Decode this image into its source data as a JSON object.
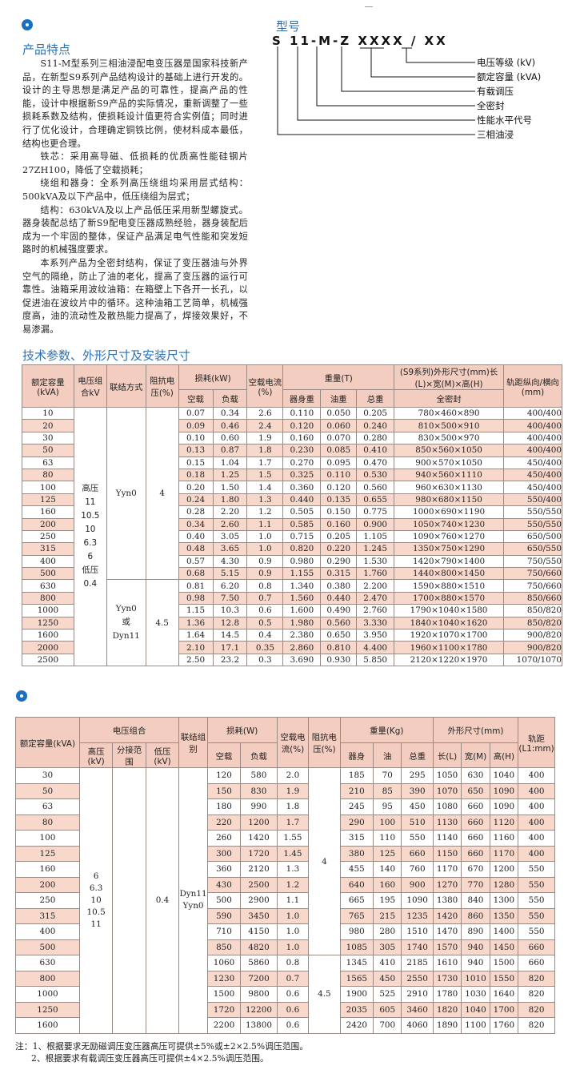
{
  "features": {
    "title": "产品特点",
    "paragraphs": [
      "S11-M型系列三相油浸配电变压器是国家科技新产品，在新型S9系列产品结构设计的基础上进行开发的。设计的主导思想是满足产品的可靠性，提高产品的性能，设计中根据新S9产品的实际情况，重新调整了一些损耗系数及结构，使损耗设计值更符合实例值；同时进行了优化设计，合理确定铜铁比例，使材料成本最低，结构也更合理。",
      "铁芯：采用高导磁、低损耗的优质高性能硅钢片27ZH100，降低了空载损耗；",
      "绕组和器身：全系列高压绕组均采用层式结构：500kVA及以下产品中，低压绕组为层式；",
      "结构：630kVA及以上产品低压采用新型螺旋式。器身装配总结了新S9配电变压器成熟经验，器身装配后成为一个牢固的整体，保证产品满足电气性能和突发短路时的机械强度要求。",
      "本系列产品为全密封结构，保证了变压器油与外界空气的隔绝，防止了油的老化，提高了变压器的运行可靠性。油箱采用波纹油箱：在箱壁上下各开一长孔，以促进油在波纹片中的循环。这种油箱工艺简单，机械强度高，油的流动性及散热能力提高了，焊接效果好，不易渗漏。"
    ]
  },
  "model": {
    "title": "型号",
    "code": "S 11-M-Z XXXX / XX",
    "labels": [
      "电压等级 (kV)",
      "额定容量 (kVA)",
      "有载调压",
      "全密封",
      "性能水平代号",
      "三相油浸"
    ]
  },
  "table1": {
    "title": "技术参数、外形尺寸及安装尺寸",
    "headers": {
      "capacity": "额定容量(kVA)",
      "voltage": "电压组合kV",
      "group": "联结方式",
      "impedance": "阻抗电压(%)",
      "loss": "损耗(kW)",
      "loss_noload": "空载",
      "loss_load": "负载",
      "noload_current": "空载电流(%)",
      "weight": "重量(T)",
      "w_body": "器身重",
      "w_oil": "油重",
      "w_total": "总重",
      "dims": "(S9系列)外形尺寸(mm)长(L)×宽(M)×高(H)",
      "dims_sub": "全密封",
      "gauge": "轨距纵向/横向(mm)"
    },
    "voltage_text": "高压 11 10.5 10 6.3 6 低压 0.4",
    "group_a": "Yyn0",
    "group_b": "Yyn0 或 Dyn11",
    "imp_a": "4",
    "imp_b": "4.5",
    "rows": [
      [
        "10",
        "0.07",
        "0.34",
        "2.6",
        "0.110",
        "0.050",
        "0.205",
        "780×460×890",
        "400/400"
      ],
      [
        "20",
        "0.09",
        "0.46",
        "2.4",
        "0.120",
        "0.060",
        "0.240",
        "810×500×910",
        "400/400"
      ],
      [
        "30",
        "0.10",
        "0.60",
        "1.9",
        "0.160",
        "0.070",
        "0.280",
        "830×500×970",
        "400/400"
      ],
      [
        "50",
        "0.13",
        "0.87",
        "1.8",
        "0.230",
        "0.085",
        "0.410",
        "850×560×1050",
        "400/400"
      ],
      [
        "63",
        "0.15",
        "1.04",
        "1.7",
        "0.270",
        "0.095",
        "0.470",
        "900×570×1050",
        "450/400"
      ],
      [
        "80",
        "0.18",
        "1.25",
        "1.5",
        "0.325",
        "0.110",
        "0.530",
        "940×560×1110",
        "450/400"
      ],
      [
        "100",
        "0.20",
        "1.50",
        "1.4",
        "0.360",
        "0.120",
        "0.560",
        "960×630×1130",
        "450/400"
      ],
      [
        "125",
        "0.24",
        "1.80",
        "1.3",
        "0.440",
        "0.135",
        "0.655",
        "980×680×1150",
        "550/400"
      ],
      [
        "160",
        "0.28",
        "2.20",
        "1.2",
        "0.505",
        "0.150",
        "0.775",
        "1000×690×1190",
        "550/550"
      ],
      [
        "200",
        "0.34",
        "2.60",
        "1.1",
        "0.585",
        "0.160",
        "0.900",
        "1050×740×1230",
        "550/550"
      ],
      [
        "250",
        "0.40",
        "3.05",
        "1.0",
        "0.715",
        "0.205",
        "1.105",
        "1090×760×1270",
        "650/500"
      ],
      [
        "315",
        "0.48",
        "3.65",
        "1.0",
        "0.820",
        "0.220",
        "1.245",
        "1350×750×1290",
        "650/550"
      ],
      [
        "400",
        "0.57",
        "4.30",
        "0.9",
        "0.980",
        "0.290",
        "1.530",
        "1420×790×1400",
        "750/550"
      ],
      [
        "500",
        "0.68",
        "5.15",
        "0.9",
        "1.155",
        "0.315",
        "1.760",
        "1440×800×1450",
        "750/660"
      ],
      [
        "630",
        "0.81",
        "6.20",
        "0.8",
        "1.340",
        "0.380",
        "2.200",
        "1590×880×1510",
        "750/660"
      ],
      [
        "800",
        "0.98",
        "7.50",
        "0.7",
        "1.560",
        "0.440",
        "2.470",
        "1700×880×1570",
        "850/660"
      ],
      [
        "1000",
        "1.15",
        "10.3",
        "0.6",
        "1.600",
        "0.490",
        "2.760",
        "1790×1040×1580",
        "850/820"
      ],
      [
        "1250",
        "1.36",
        "12.8",
        "0.5",
        "1.980",
        "0.560",
        "3.330",
        "1840×1040×1620",
        "850/820"
      ],
      [
        "1600",
        "1.64",
        "14.5",
        "0.4",
        "2.380",
        "0.650",
        "3.950",
        "1920×1070×1700",
        "900/820"
      ],
      [
        "2000",
        "2.10",
        "17.1",
        "0.35",
        "2.860",
        "0.810",
        "4.400",
        "1960×1100×1780",
        "900/820"
      ],
      [
        "2500",
        "2.50",
        "23.2",
        "0.3",
        "3.690",
        "0.930",
        "5.850",
        "2120×1220×1970",
        "1070/1070"
      ]
    ]
  },
  "table2": {
    "headers": {
      "capacity": "额定容量(kVA)",
      "voltage": "电压组合",
      "hv": "高压(kV)",
      "tap": "分接范围",
      "lv": "低压(kV)",
      "group": "联结组别",
      "loss": "损耗(W)",
      "loss_noload": "空载",
      "loss_load": "负载",
      "noload_current": "空载电流(%)",
      "impedance": "阻抗电压(%)",
      "weight": "重量(Kg)",
      "w_body": "器身",
      "w_oil": "油",
      "w_total": "总重",
      "dims": "外形尺寸(mm)",
      "d_l": "长(L)",
      "d_w": "宽(M)",
      "d_h": "高(H)",
      "gauge": "轨距(L1:mm)"
    },
    "hv_text": "6 6.3 10 10.5 11",
    "lv_text": "0.4",
    "group_text": "Dyn11 Yyn0",
    "imp_a": "4",
    "imp_b": "4.5",
    "rows": [
      [
        "30",
        "120",
        "580",
        "2.0",
        "185",
        "70",
        "295",
        "1050",
        "630",
        "1040",
        "400"
      ],
      [
        "50",
        "150",
        "830",
        "1.9",
        "210",
        "85",
        "390",
        "1070",
        "650",
        "1090",
        "400"
      ],
      [
        "63",
        "180",
        "990",
        "1.8",
        "245",
        "95",
        "450",
        "1080",
        "660",
        "1090",
        "400"
      ],
      [
        "80",
        "220",
        "1200",
        "1.7",
        "290",
        "100",
        "510",
        "1130",
        "660",
        "1120",
        "400"
      ],
      [
        "100",
        "260",
        "1420",
        "1.55",
        "315",
        "110",
        "550",
        "1140",
        "660",
        "1160",
        "400"
      ],
      [
        "125",
        "300",
        "1720",
        "1.45",
        "380",
        "125",
        "660",
        "1150",
        "660",
        "1170",
        "400"
      ],
      [
        "160",
        "360",
        "2120",
        "1.3",
        "455",
        "140",
        "760",
        "1170",
        "670",
        "1200",
        "550"
      ],
      [
        "200",
        "430",
        "2500",
        "1.2",
        "640",
        "160",
        "900",
        "1270",
        "770",
        "1280",
        "550"
      ],
      [
        "250",
        "500",
        "2900",
        "1.1",
        "665",
        "195",
        "1090",
        "1380",
        "840",
        "1300",
        "550"
      ],
      [
        "315",
        "590",
        "3450",
        "1.0",
        "765",
        "215",
        "1235",
        "1420",
        "860",
        "1350",
        "550"
      ],
      [
        "400",
        "710",
        "4150",
        "1.0",
        "980",
        "280",
        "1510",
        "1470",
        "890",
        "1400",
        "550"
      ],
      [
        "500",
        "850",
        "4820",
        "1.0",
        "1085",
        "305",
        "1740",
        "1570",
        "940",
        "1450",
        "660"
      ],
      [
        "630",
        "1060",
        "5860",
        "0.8",
        "1345",
        "410",
        "2185",
        "1610",
        "940",
        "1500",
        "660"
      ],
      [
        "800",
        "1230",
        "7200",
        "0.7",
        "1565",
        "450",
        "2550",
        "1730",
        "1010",
        "1550",
        "820"
      ],
      [
        "1000",
        "1500",
        "9800",
        "0.6",
        "1900",
        "525",
        "2910",
        "1780",
        "1030",
        "1640",
        "820"
      ],
      [
        "1250",
        "1720",
        "12200",
        "0.6",
        "2035",
        "605",
        "3460",
        "1820",
        "1040",
        "1700",
        "820"
      ],
      [
        "1600",
        "2200",
        "13800",
        "0.6",
        "2420",
        "700",
        "4060",
        "1890",
        "1100",
        "1760",
        "820"
      ]
    ]
  },
  "notes": [
    "注：1、根据要求无励磁调压变压器高压可提供±5%或±2×2.5%调压范围。",
    "2、根据要求有载调压变压器高压可提供±4×2.5%调压范围。"
  ]
}
